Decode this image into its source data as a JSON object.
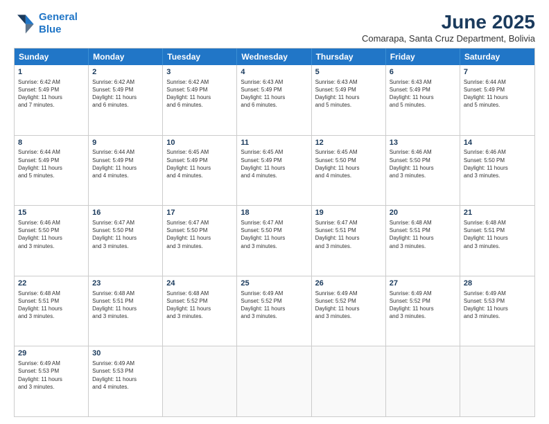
{
  "header": {
    "logo_line1": "General",
    "logo_line2": "Blue",
    "month": "June 2025",
    "location": "Comarapa, Santa Cruz Department, Bolivia"
  },
  "weekdays": [
    "Sunday",
    "Monday",
    "Tuesday",
    "Wednesday",
    "Thursday",
    "Friday",
    "Saturday"
  ],
  "rows": [
    [
      {
        "day": "1",
        "lines": [
          "Sunrise: 6:42 AM",
          "Sunset: 5:49 PM",
          "Daylight: 11 hours",
          "and 7 minutes."
        ]
      },
      {
        "day": "2",
        "lines": [
          "Sunrise: 6:42 AM",
          "Sunset: 5:49 PM",
          "Daylight: 11 hours",
          "and 6 minutes."
        ]
      },
      {
        "day": "3",
        "lines": [
          "Sunrise: 6:42 AM",
          "Sunset: 5:49 PM",
          "Daylight: 11 hours",
          "and 6 minutes."
        ]
      },
      {
        "day": "4",
        "lines": [
          "Sunrise: 6:43 AM",
          "Sunset: 5:49 PM",
          "Daylight: 11 hours",
          "and 6 minutes."
        ]
      },
      {
        "day": "5",
        "lines": [
          "Sunrise: 6:43 AM",
          "Sunset: 5:49 PM",
          "Daylight: 11 hours",
          "and 5 minutes."
        ]
      },
      {
        "day": "6",
        "lines": [
          "Sunrise: 6:43 AM",
          "Sunset: 5:49 PM",
          "Daylight: 11 hours",
          "and 5 minutes."
        ]
      },
      {
        "day": "7",
        "lines": [
          "Sunrise: 6:44 AM",
          "Sunset: 5:49 PM",
          "Daylight: 11 hours",
          "and 5 minutes."
        ]
      }
    ],
    [
      {
        "day": "8",
        "lines": [
          "Sunrise: 6:44 AM",
          "Sunset: 5:49 PM",
          "Daylight: 11 hours",
          "and 5 minutes."
        ]
      },
      {
        "day": "9",
        "lines": [
          "Sunrise: 6:44 AM",
          "Sunset: 5:49 PM",
          "Daylight: 11 hours",
          "and 4 minutes."
        ]
      },
      {
        "day": "10",
        "lines": [
          "Sunrise: 6:45 AM",
          "Sunset: 5:49 PM",
          "Daylight: 11 hours",
          "and 4 minutes."
        ]
      },
      {
        "day": "11",
        "lines": [
          "Sunrise: 6:45 AM",
          "Sunset: 5:49 PM",
          "Daylight: 11 hours",
          "and 4 minutes."
        ]
      },
      {
        "day": "12",
        "lines": [
          "Sunrise: 6:45 AM",
          "Sunset: 5:50 PM",
          "Daylight: 11 hours",
          "and 4 minutes."
        ]
      },
      {
        "day": "13",
        "lines": [
          "Sunrise: 6:46 AM",
          "Sunset: 5:50 PM",
          "Daylight: 11 hours",
          "and 3 minutes."
        ]
      },
      {
        "day": "14",
        "lines": [
          "Sunrise: 6:46 AM",
          "Sunset: 5:50 PM",
          "Daylight: 11 hours",
          "and 3 minutes."
        ]
      }
    ],
    [
      {
        "day": "15",
        "lines": [
          "Sunrise: 6:46 AM",
          "Sunset: 5:50 PM",
          "Daylight: 11 hours",
          "and 3 minutes."
        ]
      },
      {
        "day": "16",
        "lines": [
          "Sunrise: 6:47 AM",
          "Sunset: 5:50 PM",
          "Daylight: 11 hours",
          "and 3 minutes."
        ]
      },
      {
        "day": "17",
        "lines": [
          "Sunrise: 6:47 AM",
          "Sunset: 5:50 PM",
          "Daylight: 11 hours",
          "and 3 minutes."
        ]
      },
      {
        "day": "18",
        "lines": [
          "Sunrise: 6:47 AM",
          "Sunset: 5:50 PM",
          "Daylight: 11 hours",
          "and 3 minutes."
        ]
      },
      {
        "day": "19",
        "lines": [
          "Sunrise: 6:47 AM",
          "Sunset: 5:51 PM",
          "Daylight: 11 hours",
          "and 3 minutes."
        ]
      },
      {
        "day": "20",
        "lines": [
          "Sunrise: 6:48 AM",
          "Sunset: 5:51 PM",
          "Daylight: 11 hours",
          "and 3 minutes."
        ]
      },
      {
        "day": "21",
        "lines": [
          "Sunrise: 6:48 AM",
          "Sunset: 5:51 PM",
          "Daylight: 11 hours",
          "and 3 minutes."
        ]
      }
    ],
    [
      {
        "day": "22",
        "lines": [
          "Sunrise: 6:48 AM",
          "Sunset: 5:51 PM",
          "Daylight: 11 hours",
          "and 3 minutes."
        ]
      },
      {
        "day": "23",
        "lines": [
          "Sunrise: 6:48 AM",
          "Sunset: 5:51 PM",
          "Daylight: 11 hours",
          "and 3 minutes."
        ]
      },
      {
        "day": "24",
        "lines": [
          "Sunrise: 6:48 AM",
          "Sunset: 5:52 PM",
          "Daylight: 11 hours",
          "and 3 minutes."
        ]
      },
      {
        "day": "25",
        "lines": [
          "Sunrise: 6:49 AM",
          "Sunset: 5:52 PM",
          "Daylight: 11 hours",
          "and 3 minutes."
        ]
      },
      {
        "day": "26",
        "lines": [
          "Sunrise: 6:49 AM",
          "Sunset: 5:52 PM",
          "Daylight: 11 hours",
          "and 3 minutes."
        ]
      },
      {
        "day": "27",
        "lines": [
          "Sunrise: 6:49 AM",
          "Sunset: 5:52 PM",
          "Daylight: 11 hours",
          "and 3 minutes."
        ]
      },
      {
        "day": "28",
        "lines": [
          "Sunrise: 6:49 AM",
          "Sunset: 5:53 PM",
          "Daylight: 11 hours",
          "and 3 minutes."
        ]
      }
    ],
    [
      {
        "day": "29",
        "lines": [
          "Sunrise: 6:49 AM",
          "Sunset: 5:53 PM",
          "Daylight: 11 hours",
          "and 3 minutes."
        ]
      },
      {
        "day": "30",
        "lines": [
          "Sunrise: 6:49 AM",
          "Sunset: 5:53 PM",
          "Daylight: 11 hours",
          "and 4 minutes."
        ]
      },
      {
        "day": "",
        "lines": []
      },
      {
        "day": "",
        "lines": []
      },
      {
        "day": "",
        "lines": []
      },
      {
        "day": "",
        "lines": []
      },
      {
        "day": "",
        "lines": []
      }
    ]
  ]
}
